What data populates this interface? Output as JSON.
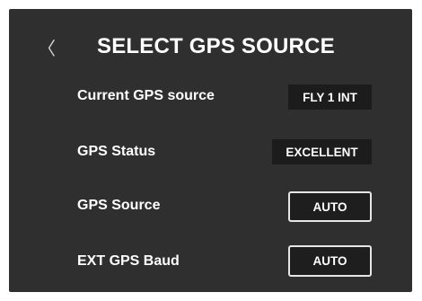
{
  "header": {
    "back_icon": "chevron-left-icon",
    "back_glyph": "〈",
    "title": "SELECT GPS SOURCE"
  },
  "rows": [
    {
      "label": "Current GPS source",
      "value": "FLY 1 INT"
    },
    {
      "label": "GPS Status",
      "value": "EXCELLENT"
    },
    {
      "label": "GPS Source",
      "value": "AUTO"
    },
    {
      "label": "EXT GPS Baud",
      "value": "AUTO"
    }
  ],
  "colors": {
    "panel": "#2f2f2f",
    "value_box": "#1c1c1c",
    "button_border": "#e6e6e6",
    "text": "#ffffff"
  }
}
